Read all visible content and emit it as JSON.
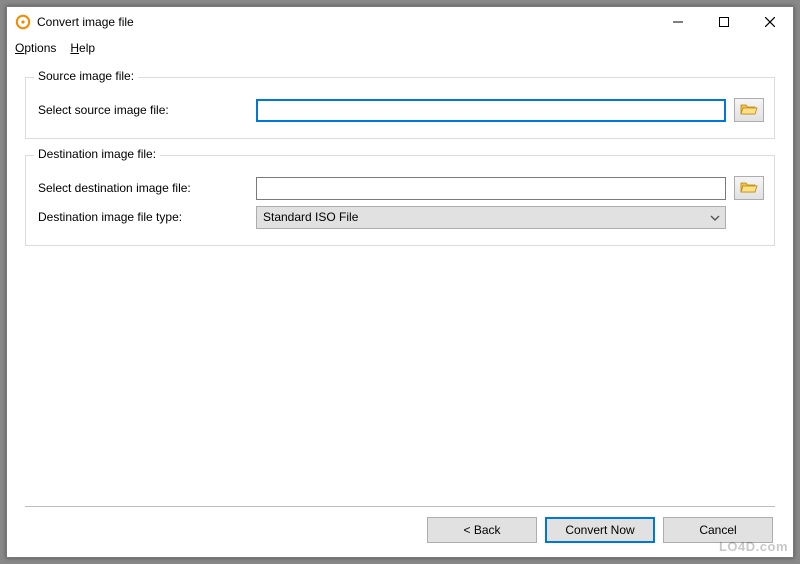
{
  "window": {
    "title": "Convert image file"
  },
  "menubar": {
    "options": "Options",
    "help": "Help"
  },
  "source": {
    "legend": "Source image file:",
    "label": "Select source image file:",
    "value": ""
  },
  "destination": {
    "legend": "Destination image file:",
    "select_label": "Select destination image file:",
    "select_value": "",
    "type_label": "Destination image file type:",
    "type_value": "Standard ISO File"
  },
  "buttons": {
    "back": "< Back",
    "convert": "Convert Now",
    "cancel": "Cancel"
  },
  "icons": {
    "browse": "folder-open-icon"
  },
  "watermark": "LO4D.com"
}
